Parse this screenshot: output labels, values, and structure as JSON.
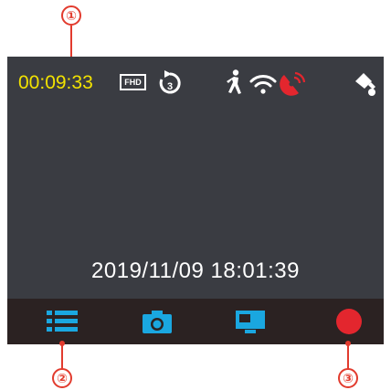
{
  "callouts": {
    "one": "①",
    "two": "②",
    "three": "③"
  },
  "status": {
    "recording_time": "00:09:33",
    "resolution_badge": "FHD",
    "loop_minutes": "3"
  },
  "datetime": "2019/11/09  18:01:39",
  "toolbar": {
    "menu_icon": "list-icon",
    "photo_icon": "camera-icon",
    "playback_icon": "monitor-icon",
    "record_icon": "record-icon"
  },
  "colors": {
    "accent_cyan": "#1aa7e0",
    "record_red": "#e3262e",
    "time_yellow": "#f2e200",
    "callout_red": "#e23b2e"
  }
}
